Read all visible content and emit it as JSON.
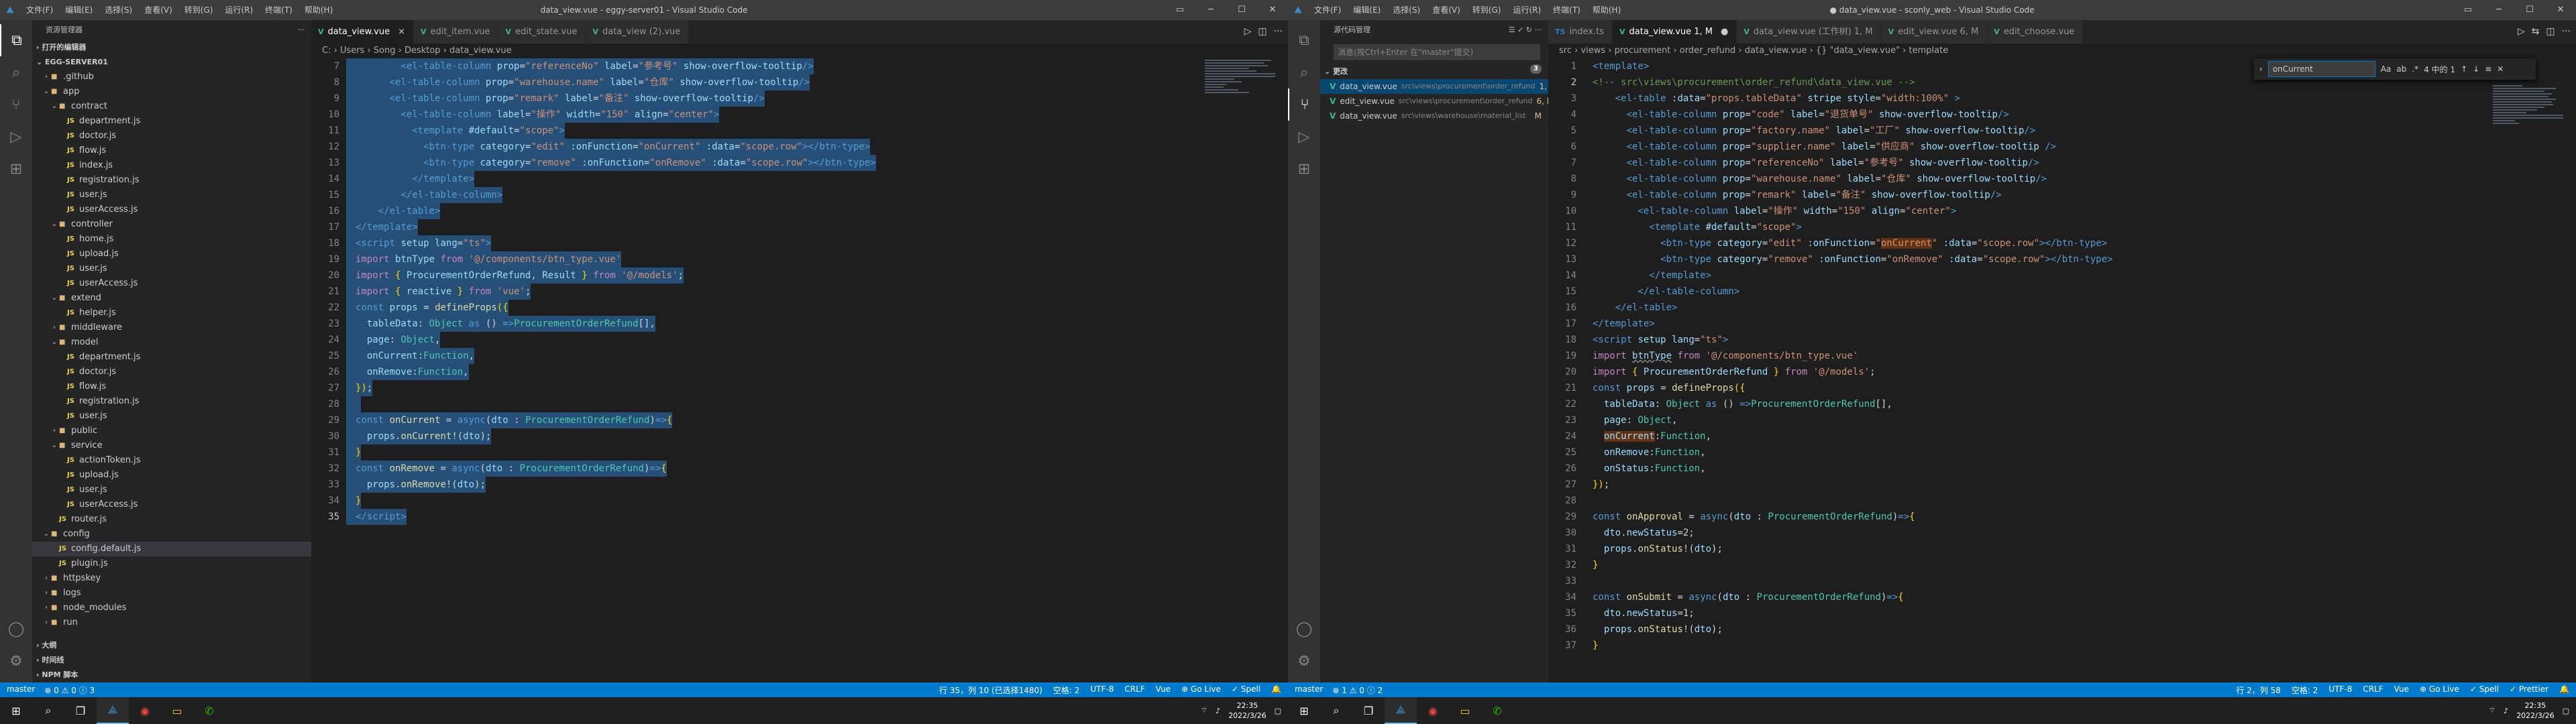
{
  "left": {
    "menu": [
      "文件(F)",
      "编辑(E)",
      "选择(S)",
      "查看(V)",
      "转到(G)",
      "运行(R)",
      "终端(T)",
      "帮助(H)"
    ],
    "window_title": "data_view.vue - eggy-server01 - Visual Studio Code",
    "explorer_title": "资源管理器",
    "open_editors": "打开的编辑器",
    "project": "EGG-SERVER01",
    "tree": [
      {
        "d": 0,
        "t": "folder",
        "n": ".github",
        "open": false
      },
      {
        "d": 0,
        "t": "folder",
        "n": "app",
        "open": true
      },
      {
        "d": 1,
        "t": "folder",
        "n": "contract",
        "open": true
      },
      {
        "d": 2,
        "t": "js",
        "n": "department.js"
      },
      {
        "d": 2,
        "t": "js",
        "n": "doctor.js"
      },
      {
        "d": 2,
        "t": "js",
        "n": "flow.js"
      },
      {
        "d": 2,
        "t": "js",
        "n": "index.js"
      },
      {
        "d": 2,
        "t": "js",
        "n": "registration.js"
      },
      {
        "d": 2,
        "t": "js",
        "n": "user.js"
      },
      {
        "d": 2,
        "t": "js",
        "n": "userAccess.js"
      },
      {
        "d": 1,
        "t": "folder",
        "n": "controller",
        "open": true
      },
      {
        "d": 2,
        "t": "js",
        "n": "home.js"
      },
      {
        "d": 2,
        "t": "js",
        "n": "upload.js"
      },
      {
        "d": 2,
        "t": "js",
        "n": "user.js"
      },
      {
        "d": 2,
        "t": "js",
        "n": "userAccess.js"
      },
      {
        "d": 1,
        "t": "folder",
        "n": "extend",
        "open": true
      },
      {
        "d": 2,
        "t": "js",
        "n": "helper.js"
      },
      {
        "d": 1,
        "t": "folder",
        "n": "middleware",
        "open": false
      },
      {
        "d": 1,
        "t": "folder",
        "n": "model",
        "open": true
      },
      {
        "d": 2,
        "t": "js",
        "n": "department.js"
      },
      {
        "d": 2,
        "t": "js",
        "n": "doctor.js"
      },
      {
        "d": 2,
        "t": "js",
        "n": "flow.js"
      },
      {
        "d": 2,
        "t": "js",
        "n": "registration.js"
      },
      {
        "d": 2,
        "t": "js",
        "n": "user.js"
      },
      {
        "d": 1,
        "t": "folder",
        "n": "public",
        "open": false
      },
      {
        "d": 1,
        "t": "folder",
        "n": "service",
        "open": true
      },
      {
        "d": 2,
        "t": "js",
        "n": "actionToken.js"
      },
      {
        "d": 2,
        "t": "js",
        "n": "upload.js"
      },
      {
        "d": 2,
        "t": "js",
        "n": "user.js"
      },
      {
        "d": 2,
        "t": "js",
        "n": "userAccess.js"
      },
      {
        "d": 1,
        "t": "js",
        "n": "router.js"
      },
      {
        "d": 0,
        "t": "folder",
        "n": "config",
        "open": true
      },
      {
        "d": 1,
        "t": "js",
        "n": "config.default.js",
        "sel": true
      },
      {
        "d": 1,
        "t": "js",
        "n": "plugin.js"
      },
      {
        "d": 0,
        "t": "folder",
        "n": "httpskey",
        "open": false
      },
      {
        "d": 0,
        "t": "folder",
        "n": "logs",
        "open": false
      },
      {
        "d": 0,
        "t": "folder",
        "n": "node_modules",
        "open": false
      },
      {
        "d": 0,
        "t": "folder",
        "n": "run",
        "open": false
      }
    ],
    "outline": "大纲",
    "timeline": "时间线",
    "npm": "NPM 脚本",
    "tabs": [
      {
        "label": "data_view.vue",
        "active": true,
        "close": "×"
      },
      {
        "label": "edit_item.vue",
        "active": false,
        "close": ""
      },
      {
        "label": "edit_state.vue",
        "active": false,
        "close": ""
      },
      {
        "label": "data_view (2).vue",
        "active": false,
        "close": ""
      }
    ],
    "breadcrumb": "C: › Users › Song › Desktop › data_view.vue",
    "status_left": [
      "master",
      "⊗ 0 ⚠ 0 ⓘ 3"
    ],
    "status_right": [
      "行 35，列 10 (已选择1480)",
      "空格: 2",
      "UTF-8",
      "CRLF",
      "Vue",
      "⊕ Go Live",
      "✓ Spell",
      "🔔"
    ]
  },
  "right": {
    "menu": [
      "文件(F)",
      "编辑(E)",
      "选择(S)",
      "查看(V)",
      "转到(G)",
      "运行(R)",
      "终端(T)",
      "帮助(H)"
    ],
    "window_title": "● data_view.vue - sconly_web - Visual Studio Code",
    "scm_title": "源代码管理",
    "scm_input_placeholder": "消息(按Ctrl+Enter 在\"master\"提交)",
    "changes_label": "更改",
    "changes_count": "3",
    "changes": [
      {
        "file": "data_view.vue",
        "path": "src\\views\\procurement\\order_refund",
        "st": "1, M",
        "sel": true
      },
      {
        "file": "edit_view.vue",
        "path": "src\\views\\procurement\\order_refund",
        "st": "6, M",
        "sel": false
      },
      {
        "file": "data_view.vue",
        "path": "src\\views\\warehouse\\material_list",
        "st": "M",
        "sel": false
      }
    ],
    "tabs": [
      {
        "label": "index.ts",
        "active": false,
        "close": ""
      },
      {
        "label": "data_view.vue 1, M",
        "active": true,
        "close": "●"
      },
      {
        "label": "data_view.vue (工作树) 1, M",
        "active": false,
        "close": ""
      },
      {
        "label": "edit_view.vue 6, M",
        "active": false,
        "close": ""
      },
      {
        "label": "edit_choose.vue",
        "active": false,
        "close": ""
      }
    ],
    "breadcrumb": "src › views › procurement › order_refund › data_view.vue › {} \"data_view.vue\" › template",
    "find_value": "onCurrent",
    "find_result": "4 中的 1",
    "status_left": [
      "master",
      "⊗ 1 ⚠ 0 ⓘ 2"
    ],
    "status_right": [
      "行 2，列 58",
      "空格: 2",
      "UTF-8",
      "CRLF",
      "Vue",
      "⊕ Go Live",
      "✓ Spell",
      "✓ Prettier",
      "🔔"
    ]
  },
  "taskbar": {
    "time": "22:35",
    "date": "2022/3/26"
  }
}
